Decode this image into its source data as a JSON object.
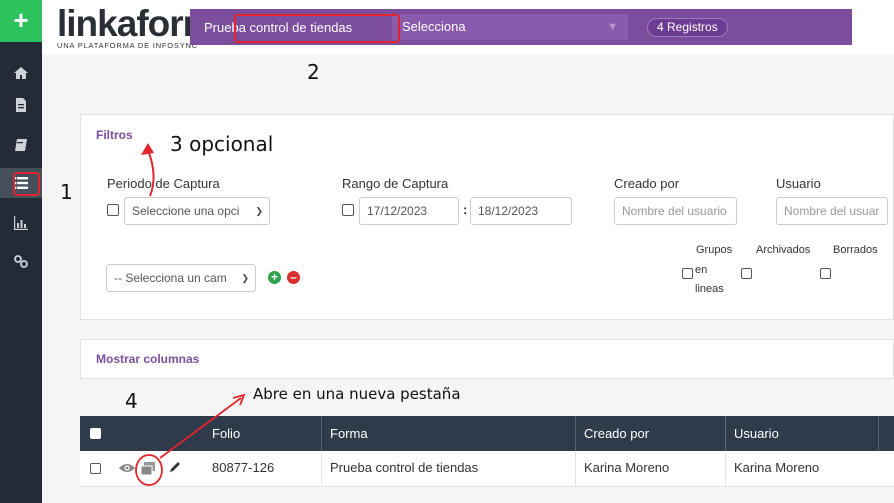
{
  "app": {
    "add_label": "+",
    "logo_text": "linkaform",
    "logo_subtitle": "UNA PLATAFORMA DE INFOSYNC"
  },
  "sidebar": {
    "items": [
      {
        "icon": "home-icon"
      },
      {
        "icon": "document-icon"
      },
      {
        "icon": "book-icon"
      },
      {
        "icon": "list-icon",
        "active": true
      },
      {
        "icon": "chart-icon"
      },
      {
        "icon": "link-icon"
      }
    ]
  },
  "topbar": {
    "form_name": "Prueba control de tiendas",
    "select_value": "Selecciona",
    "records": "4 Registros"
  },
  "filters": {
    "title": "Filtros",
    "periodo_label": "Periodo de Captura",
    "periodo_placeholder": "Seleccione una opci",
    "rango_label": "Rango de Captura",
    "fecha_inicio": "17/12/2023",
    "separator": ":",
    "fecha_fin": "18/12/2023",
    "creado_label": "Creado por",
    "creado_placeholder": "Nombre del usuario",
    "usuario_label": "Usuario",
    "usuario_placeholder": "Nombre del usuar",
    "campo_placeholder": "-- Selecciona un cam",
    "grupos_label": "Grupos",
    "en_lineas_label_1": "en",
    "en_lineas_label_2": "lineas",
    "archivados_label": "Archivados",
    "borrados_label": "Borrados"
  },
  "columns_panel": {
    "title": "Mostrar columnas"
  },
  "table": {
    "headers": [
      "Folio",
      "Forma",
      "Creado por",
      "Usuario"
    ],
    "rows": [
      {
        "folio": "80877-126",
        "forma": "Prueba control de tiendas",
        "creado_por": "Karina Moreno",
        "usuario": "Karina Moreno"
      }
    ]
  },
  "annotations": {
    "n1": "1",
    "n2": "2",
    "n3": "3 opcional",
    "n4": "4",
    "note": "Abre en una nueva pestaña"
  },
  "colors": {
    "brand_purple": "#7b4d9c",
    "sidebar": "#232b36",
    "add_green": "#2fc35e",
    "table_header": "#2f3b4b",
    "annotation_red": "#e1262d"
  }
}
